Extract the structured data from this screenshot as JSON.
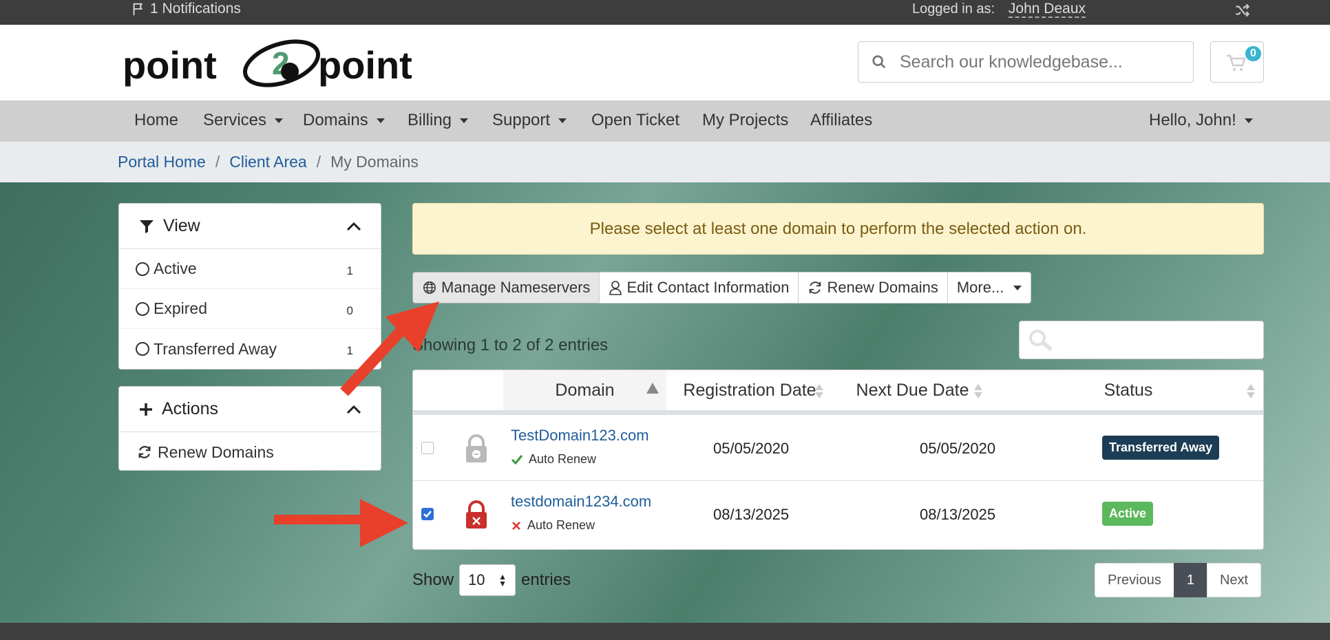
{
  "topbar": {
    "notifications": "1 Notifications",
    "logged_in_label": "Logged in as:",
    "user_name": "John Deaux"
  },
  "header": {
    "logo_text_left": "point",
    "logo_number": "2",
    "logo_text_right": "point",
    "search_placeholder": "Search our knowledgebase...",
    "cart_count": "0"
  },
  "nav": {
    "items": [
      {
        "label": "Home"
      },
      {
        "label": "Services"
      },
      {
        "label": "Domains"
      },
      {
        "label": "Billing"
      },
      {
        "label": "Support"
      },
      {
        "label": "Open Ticket"
      },
      {
        "label": "My Projects"
      },
      {
        "label": "Affiliates"
      }
    ],
    "user_menu": "Hello, John!"
  },
  "breadcrumb": {
    "items": [
      "Portal Home",
      "Client Area",
      "My Domains"
    ],
    "separator": "/"
  },
  "sidebar": {
    "view": {
      "title": "View",
      "items": [
        {
          "label": "Active",
          "count": "1"
        },
        {
          "label": "Expired",
          "count": "0"
        },
        {
          "label": "Transferred Away",
          "count": "1"
        }
      ]
    },
    "actions": {
      "title": "Actions",
      "items": [
        {
          "label": "Renew Domains"
        }
      ]
    }
  },
  "alert": "Please select at least one domain to perform the selected action on.",
  "toolbar": {
    "manage_nameservers": "Manage Nameservers",
    "edit_contact": "Edit Contact Information",
    "renew_domains": "Renew Domains",
    "more": "More..."
  },
  "table": {
    "showing": "Showing 1 to 2 of 2 entries",
    "columns": [
      "Domain",
      "Registration Date",
      "Next Due Date",
      "Status"
    ],
    "rows": [
      {
        "checked": false,
        "domain": "TestDomain123.com",
        "auto_renew": "Auto Renew",
        "auto_renew_on": true,
        "registration": "05/05/2020",
        "next_due": "05/05/2020",
        "status": "Transferred Away",
        "status_color": "#1c3d55",
        "lock_color": "#b9b9b9"
      },
      {
        "checked": true,
        "domain": "testdomain1234.com",
        "auto_renew": "Auto Renew",
        "auto_renew_on": false,
        "registration": "08/13/2025",
        "next_due": "08/13/2025",
        "status": "Active",
        "status_color": "#5cb85c",
        "lock_color": "#c9302c"
      }
    ]
  },
  "footer_controls": {
    "show_label": "Show",
    "entries_value": "10",
    "entries_label": "entries",
    "previous": "Previous",
    "current_page": "1",
    "next": "Next"
  },
  "colors": {
    "link": "#1f5c99",
    "annotation_arrow": "#e8402a"
  }
}
